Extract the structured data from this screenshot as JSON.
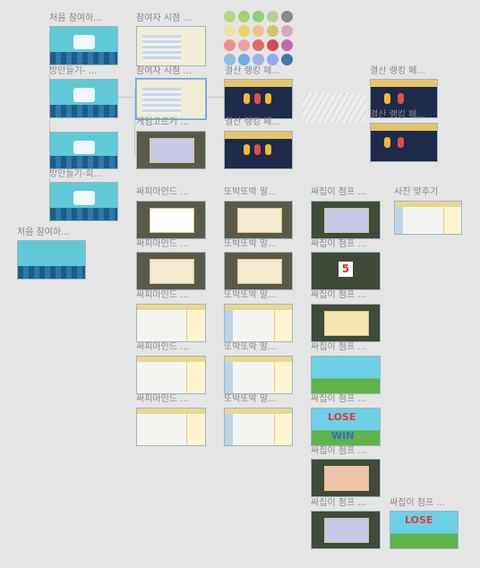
{
  "labels": {
    "first_visit_1": "처음 참여하...",
    "room_create_1": "방만들기- ...",
    "room_create_2": "방만들기-회...",
    "first_visit_2": "처음 참여하...",
    "participant_view_1": "참여자 시점 ...",
    "participant_view_2": "참여자 시점 ...",
    "game_select": "게임고르기 ...",
    "result_rank_1": "결산 랭킹 페...",
    "result_rank_2": "결산 랭킹 페...",
    "result_rank_3": "결산 랭킹 페...",
    "result_rank_4": "결산 랭킹 페...",
    "quick_mind_1": "싸피마인드 ...",
    "quick_mind_2": "싸피마인드 ...",
    "quick_mind_3": "싸피마인드 ...",
    "quick_mind_4": "싸피마인드 ...",
    "quick_mind_5": "싸피마인드 ...",
    "clip_1": "또박또박 말...",
    "clip_2": "또박또박 말...",
    "clip_3": "또박또박 말...",
    "clip_4": "또박또박 말...",
    "clip_5": "또박또박 말...",
    "jump_1": "싸집이 점프 ...",
    "jump_2": "싸집이 점프 ...",
    "jump_3": "싸집이 점프 ...",
    "jump_4": "싸집이 점프 ...",
    "jump_5": "싸집이 점프 ...",
    "jump_6": "싸집이 점프 ...",
    "jump_7": "싸집이 점프 ...",
    "jump_8": "싸집이 점프 ...",
    "photo_match": "사진 맞추기"
  },
  "screen_text": {
    "lose_1": "LOSE",
    "win_1": "WIN",
    "lose_2": "LOSE",
    "countdown": "5"
  },
  "palette": [
    "#b4d98a",
    "#a8d06a",
    "#8dd07a",
    "#b8cf9a",
    "#8a8a85",
    "#f2dfa3",
    "#f2d16a",
    "#f0c48a",
    "#d8c46a",
    "#d5a8c8",
    "#f08f8f",
    "#f0a0a0",
    "#e06a6a",
    "#d64a5a",
    "#c06ab0",
    "#8ac0e6",
    "#6ab0e0",
    "#a0b0e8",
    "#90a8f0",
    "#3c7aa8"
  ]
}
